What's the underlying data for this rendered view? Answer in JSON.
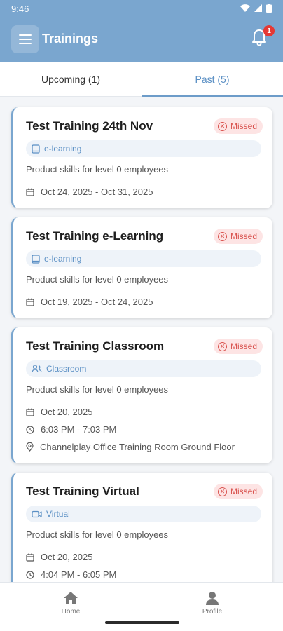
{
  "status_bar": {
    "time": "9:46"
  },
  "app_bar": {
    "title": "Trainings",
    "notification_count": "1"
  },
  "tabs": [
    {
      "label": "Upcoming (1)",
      "active": false
    },
    {
      "label": "Past (5)",
      "active": true
    }
  ],
  "trainings": [
    {
      "title": "Test Training 24th Nov",
      "status": "Missed",
      "type": "e-learning",
      "type_icon": "book-icon",
      "description": "Product skills for level 0 employees",
      "dates": "Oct 24, 2025 - Oct 31, 2025"
    },
    {
      "title": "Test Training e-Learning",
      "status": "Missed",
      "type": "e-learning",
      "type_icon": "book-icon",
      "description": "Product skills for level 0 employees",
      "dates": "Oct 19, 2025 - Oct 24, 2025"
    },
    {
      "title": "Test Training Classroom",
      "status": "Missed",
      "type": "Classroom",
      "type_icon": "people-icon",
      "description": "Product skills for level 0 employees",
      "dates": "Oct 20, 2025",
      "time": "6:03 PM - 7:03 PM",
      "location": "Channelplay Office Training Room Ground Floor"
    },
    {
      "title": "Test Training Virtual",
      "status": "Missed",
      "type": "Virtual",
      "type_icon": "video-icon",
      "description": "Product skills for level 0 employees",
      "dates": "Oct 20, 2025",
      "time": "4:04 PM - 6:05 PM"
    }
  ],
  "bottom_nav": [
    {
      "label": "Home",
      "icon": "home-icon"
    },
    {
      "label": "Profile",
      "icon": "person-icon"
    }
  ],
  "colors": {
    "header": "#7aa6cf",
    "accent": "#5a8fc4",
    "missed": "#d9534f",
    "missed_bg": "#fde4e4"
  }
}
